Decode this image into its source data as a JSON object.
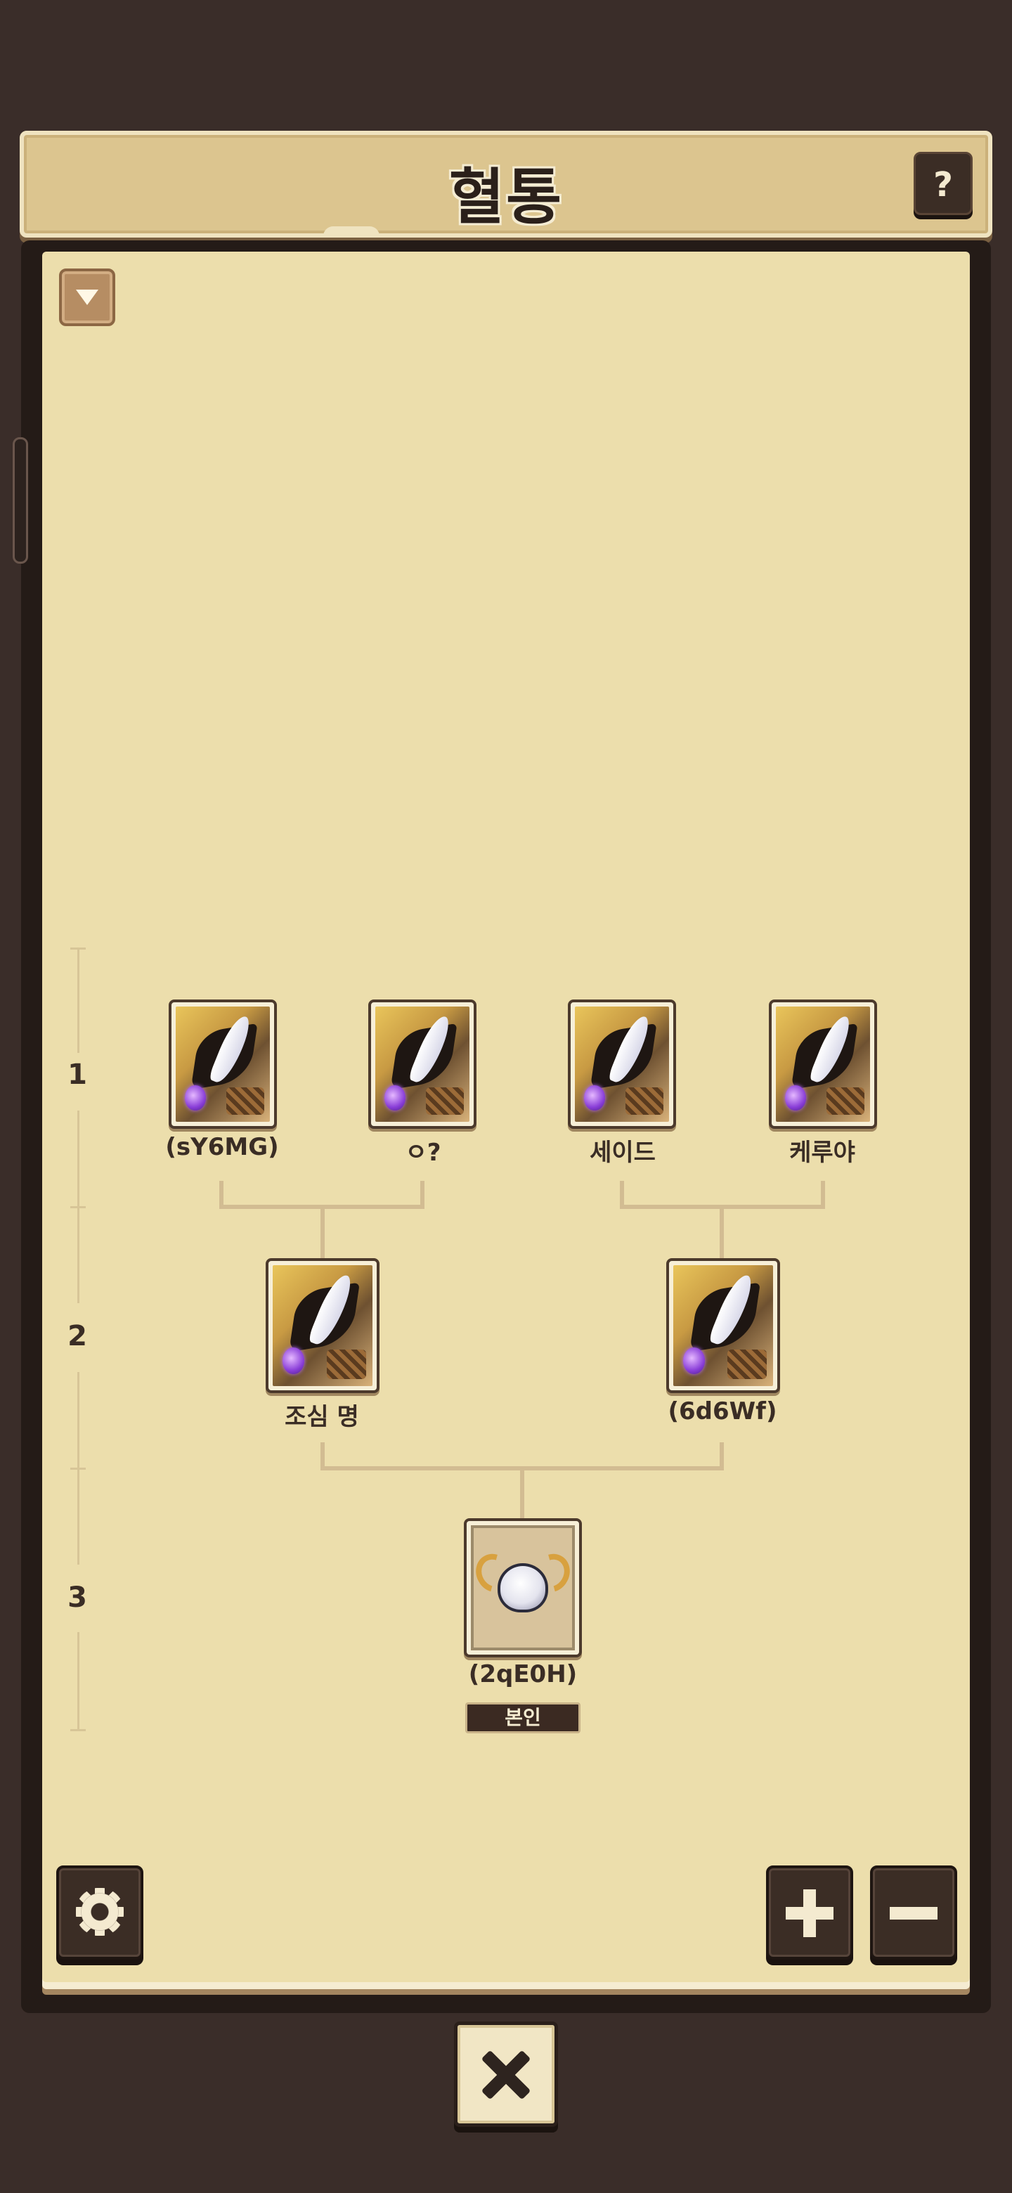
{
  "header": {
    "title": "혈통",
    "help_label": "?"
  },
  "generations": [
    "1",
    "2",
    "3"
  ],
  "tree": {
    "gen1": [
      {
        "name": "(sY6MG)"
      },
      {
        "name": "ㅇ?"
      },
      {
        "name": "세이드"
      },
      {
        "name": "케루야"
      }
    ],
    "gen2": [
      {
        "name": "조심 명"
      },
      {
        "name": "(6d6Wf)"
      }
    ],
    "gen3": {
      "name": "(2qE0H)",
      "badge": "본인"
    }
  },
  "icons": {
    "help": "question-icon",
    "collapse": "chevron-down-icon",
    "settings": "gear-icon",
    "zoom_in": "plus-icon",
    "zoom_out": "minus-icon",
    "close": "close-icon"
  }
}
